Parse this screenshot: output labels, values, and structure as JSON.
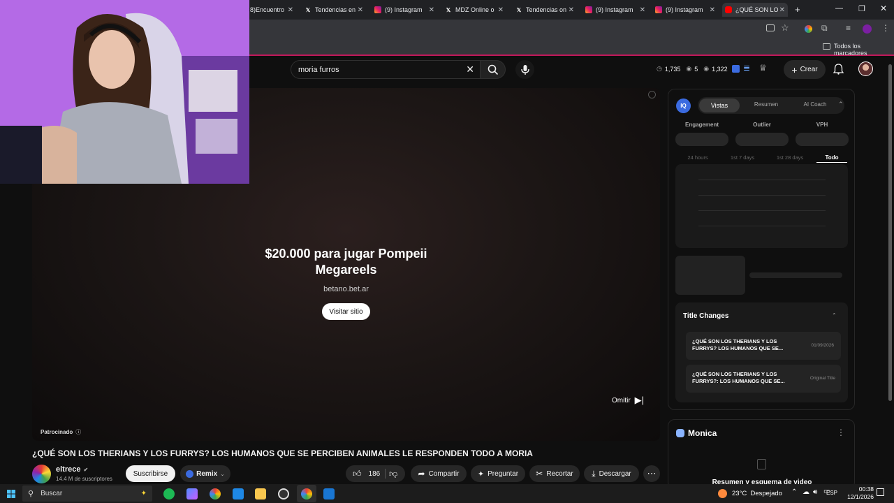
{
  "browser": {
    "tabs": [
      {
        "label": "8)Encuentro",
        "icon": "generic"
      },
      {
        "label": "Tendencias en",
        "icon": "x"
      },
      {
        "label": "(9) Instagram",
        "icon": "instagram"
      },
      {
        "label": "MDZ Online o",
        "icon": "x"
      },
      {
        "label": "Tendencias on",
        "icon": "x"
      },
      {
        "label": "(9) Instagram",
        "icon": "instagram"
      },
      {
        "label": "(9) Instagram",
        "icon": "instagram"
      },
      {
        "label": "¿QUÉ SON LO",
        "icon": "youtube"
      }
    ],
    "bookmarks_label": "Todos los marcadores"
  },
  "header": {
    "search_value": "moria furros",
    "stats": [
      "1,735",
      "5",
      "1,322"
    ],
    "create_label": "Crear"
  },
  "ad": {
    "title": "$20.000 para jugar Pompeii Megareels",
    "domain": "betano.bet.ar",
    "visit_label": "Visitar sitio",
    "skip_label": "Omitir",
    "sponsored_label": "Patrocinado"
  },
  "video": {
    "title": "¿QUÉ SON LOS THERIANS Y LOS FURRYS? LOS HUMANOS QUE SE PERCIBEN ANIMALES LE RESPONDEN TODO A MORIA",
    "channel": "eltrece",
    "subscribers": "14.4 M de suscriptores",
    "subscribe_label": "Suscribirse",
    "remix_label": "Remix",
    "likes": "186",
    "share_label": "Compartir",
    "ask_label": "Preguntar",
    "clip_label": "Recortar",
    "download_label": "Descargar"
  },
  "vidiq": {
    "logo": "IQ",
    "tabs": [
      "Vistas",
      "Resumen",
      "AI Coach"
    ],
    "metrics": [
      "Engagement",
      "Outlier",
      "VPH"
    ],
    "ranges": [
      "24 hours",
      "1st 7 days",
      "1st 28 days",
      "Todo"
    ],
    "title_changes_label": "Title Changes",
    "title_changes": [
      {
        "title": "¿QUÉ SON LOS THERIANS Y LOS FURRYS? LOS HUMANOS QUE SE...",
        "meta": "01/09/2026"
      },
      {
        "title": "¿QUÉ SON LOS THERIANS Y LOS FURRYS?: LOS HUMANOS QUE SE...",
        "meta": "Original Title"
      }
    ]
  },
  "monica": {
    "title": "Monica",
    "subtitle": "Resumen y esquema de video"
  },
  "taskbar": {
    "search_label": "Buscar",
    "weather": "23°C  Despejado",
    "lang": "ESP",
    "time": "00:38",
    "date": "12/1/2026"
  }
}
